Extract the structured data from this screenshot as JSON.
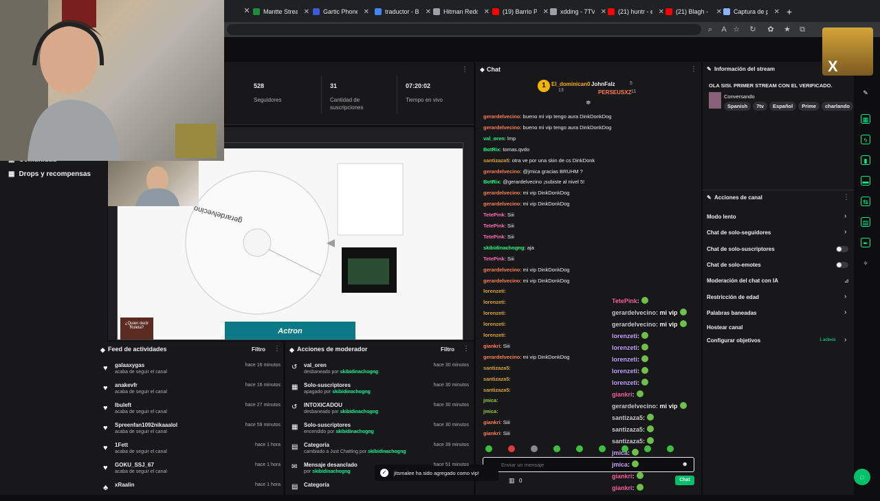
{
  "browser": {
    "tabs": [
      {
        "label": "Mantte Strea",
        "color": "#1e8e3e"
      },
      {
        "label": "Gartic Phone",
        "color": "#3b5bdb"
      },
      {
        "label": "traductor - B",
        "color": "#4285f4"
      },
      {
        "label": "Hitman Redd",
        "color": "#9aa0a6"
      },
      {
        "label": "(19) Barrio P",
        "color": "#ff0000"
      },
      {
        "label": "xdding - 7TV",
        "color": "#9aa0a6"
      },
      {
        "label": "(21) huntr - e",
        "color": "#ff0000"
      },
      {
        "label": "(21) Blagh - l",
        "color": "#ff0000"
      },
      {
        "label": "Captura de p",
        "color": "#8ab4f8"
      }
    ],
    "new_tab": "+"
  },
  "leftnav": {
    "items": [
      {
        "label": "Comunidad"
      },
      {
        "label": "Drops y recompensas"
      }
    ]
  },
  "stats": {
    "items": [
      {
        "value": "528",
        "label": "Seguidores"
      },
      {
        "value": "31",
        "label": "Cantidad de suscripciones"
      },
      {
        "value": "07:20:02",
        "label": "Tiempo en vivo"
      }
    ]
  },
  "preview": {
    "wheel_label": "gerardelvecino",
    "banner": "Actron",
    "thumb_text": "¿Quien decir Ruleta?"
  },
  "activity": {
    "title": "Feed de actividades",
    "filter": "Filtro",
    "rows": [
      {
        "name": "galaaxygas",
        "sub": "acaba de seguir el canal",
        "time": "hace 16 minutos"
      },
      {
        "name": "anakevfr",
        "sub": "acaba de seguir el canal",
        "time": "hace 16 minutos"
      },
      {
        "name": "lbuleft",
        "sub": "acaba de seguir el canal",
        "time": "hace 27 minutos"
      },
      {
        "name": "Spreenfan1092nikaaalol",
        "sub": "acaba de seguir el canal",
        "time": "hace 59 minutos"
      },
      {
        "name": "1Fett",
        "sub": "acaba de seguir el canal",
        "time": "hace 1 hora"
      },
      {
        "name": "GOKU_SSJ_67",
        "sub": "acaba de seguir el canal",
        "time": "hace 1 hora"
      },
      {
        "name": "xRaalin",
        "sub": "",
        "time": "hace 1 hora"
      }
    ]
  },
  "modactions": {
    "title": "Acciones de moderador",
    "filter": "Filtro",
    "rows": [
      {
        "name": "val_oren",
        "sub": "desbaneado por",
        "by": "skibidinachogng",
        "time": "hace 30 minutos"
      },
      {
        "name": "Solo-suscriptores",
        "sub": "apagado por",
        "by": "skibidinachogng",
        "time": "hace 30 minutos"
      },
      {
        "name": "INTOXICADOU",
        "sub": "desbaneado por",
        "by": "skibidinachogng",
        "time": "hace 30 minutos"
      },
      {
        "name": "Solo-suscriptores",
        "sub": "encendido por",
        "by": "skibidinachogng",
        "time": "hace 30 minutos"
      },
      {
        "name": "Categoría",
        "sub": "cambiado a Just Chatting por",
        "by": "skibidinachogng",
        "time": "hace 39 minutos"
      },
      {
        "name": "Mensaje desanclado",
        "sub": "por",
        "by": "skibidinachogng",
        "time": "hace 51 minutos"
      },
      {
        "name": "Categoría",
        "sub": "",
        "by": "",
        "time": ""
      }
    ]
  },
  "chat": {
    "title": "Chat",
    "pinned": {
      "top1": "El_dominican0",
      "top1_count": "13",
      "top2": "JohnFalz",
      "top2_count": "5",
      "top3": "PERSEUSXZ",
      "top3_count": "11"
    },
    "messages": [
      {
        "user": "gerardelvecino",
        "text": ": bueno mi vip tengo aura DinkDonkDog",
        "cls": "u-g"
      },
      {
        "user": "gerardelvecino",
        "text": ": bueno mi vip tengo aura DinkDonkDog",
        "cls": "u-g"
      },
      {
        "user": "val_oren",
        "text": ": lmp",
        "cls": "u-b"
      },
      {
        "user": "BotRix",
        "text": ": tomas.qvdo",
        "cls": "u-b"
      },
      {
        "user": "santizaza5",
        "text": ": otra ve por una skin de cs DinkDonk",
        "cls": "u-y"
      },
      {
        "user": "gerardelvecino",
        "text": ": @jmica gracias BRUHM ?",
        "cls": "u-g"
      },
      {
        "user": "BotRix",
        "text": ": @gerardelvecino ¡subiste al nivel 5!",
        "cls": "u-b"
      },
      {
        "user": "gerardelvecino",
        "text": ": mi vip DinkDonkDog",
        "cls": "u-g"
      },
      {
        "user": "gerardelvecino",
        "text": ": mi vip DinkDonkDog",
        "cls": "u-g"
      },
      {
        "user": "TetePink",
        "text": ": Siii",
        "cls": "u-p"
      },
      {
        "user": "TetePink",
        "text": ": Siii",
        "cls": "u-p"
      },
      {
        "user": "TetePink",
        "text": ": Siii",
        "cls": "u-p"
      },
      {
        "user": "skibidinachogng",
        "text": ": aja",
        "cls": "u-b"
      },
      {
        "user": "TetePink",
        "text": ": Siii",
        "cls": "u-p"
      },
      {
        "user": "gerardelvecino",
        "text": ": mi vip DinkDonkDog",
        "cls": "u-g"
      },
      {
        "user": "gerardelvecino",
        "text": ": mi vip DinkDonkDog",
        "cls": "u-g"
      },
      {
        "user": "lorenzeti",
        "text": ":",
        "cls": "u-y"
      },
      {
        "user": "lorenzeti",
        "text": ":",
        "cls": "u-y"
      },
      {
        "user": "lorenzeti",
        "text": ":",
        "cls": "u-y"
      },
      {
        "user": "lorenzeti",
        "text": ":",
        "cls": "u-y"
      },
      {
        "user": "lorenzeti",
        "text": ":",
        "cls": "u-y"
      },
      {
        "user": "giankri",
        "text": ": Siii",
        "cls": "u-g"
      },
      {
        "user": "gerardelvecino",
        "text": ": mi vip DinkDonkDog",
        "cls": "u-g"
      },
      {
        "user": "santizaza5",
        "text": ":",
        "cls": "u-y"
      },
      {
        "user": "santizaza5",
        "text": ":",
        "cls": "u-y"
      },
      {
        "user": "santizaza5",
        "text": ":",
        "cls": "u-y"
      },
      {
        "user": "jmica",
        "text": ":",
        "cls": "u-c"
      },
      {
        "user": "jmica",
        "text": ":",
        "cls": "u-c"
      },
      {
        "user": "giankri",
        "text": ": Siii",
        "cls": "u-g"
      },
      {
        "user": "giankri",
        "text": ": Siii",
        "cls": "u-g"
      }
    ],
    "overlay": [
      {
        "name": "TetePink",
        "text": ":",
        "cls": "nm-p"
      },
      {
        "name": "gerardelvecino",
        "text": ": mi vip",
        "cls": "nm-g"
      },
      {
        "name": "gerardelvecino",
        "text": ": mi vip",
        "cls": "nm-g"
      },
      {
        "name": "lorenzeti",
        "text": ":",
        "cls": "nm-l"
      },
      {
        "name": "lorenzeti",
        "text": ":",
        "cls": "nm-l"
      },
      {
        "name": "lorenzeti",
        "text": ":",
        "cls": "nm-l"
      },
      {
        "name": "lorenzeti",
        "text": ":",
        "cls": "nm-l"
      },
      {
        "name": "lorenzeti",
        "text": ":",
        "cls": "nm-l"
      },
      {
        "name": "giankri",
        "text": ":",
        "cls": "nm-p"
      },
      {
        "name": "gerardelvecino",
        "text": ": mi vip",
        "cls": "nm-g"
      },
      {
        "name": "santizaza5",
        "text": ":",
        "cls": "nm-g"
      },
      {
        "name": "santizaza5",
        "text": ":",
        "cls": "nm-g"
      },
      {
        "name": "santizaza5",
        "text": ":",
        "cls": "nm-g"
      },
      {
        "name": "jmica",
        "text": ":",
        "cls": "nm-l"
      },
      {
        "name": "jmica",
        "text": ":",
        "cls": "nm-l"
      },
      {
        "name": "giankri",
        "text": ":",
        "cls": "nm-p"
      },
      {
        "name": "giankri",
        "text": ":",
        "cls": "nm-p"
      }
    ],
    "input_placeholder": "Enviar un mensaje",
    "send_label": "Chat",
    "points": "0"
  },
  "streaminfo": {
    "title": "Información del stream",
    "stream_title": "OLA SISI. PRIMER STREAM CON EL VERIFICADO.",
    "category": "Conversando",
    "tags": [
      "Spanish",
      "7tv",
      "Español",
      "Prime",
      "charlando"
    ]
  },
  "channel_actions": {
    "title": "Acciones de canal",
    "items": [
      {
        "label": "Modo lento",
        "kind": "chevron"
      },
      {
        "label": "Chat de solo-seguidores",
        "kind": "chevron"
      },
      {
        "label": "Chat de solo-suscriptores",
        "kind": "toggle"
      },
      {
        "label": "Chat de solo-emotes",
        "kind": "toggle"
      },
      {
        "label": "Moderación del chat con IA",
        "kind": "icon"
      },
      {
        "label": "Restricción de edad",
        "kind": "chevron"
      },
      {
        "label": "Palabras baneadas",
        "kind": "chevron"
      },
      {
        "label": "Hostear canal",
        "kind": "none"
      },
      {
        "label": "Configurar objetivos",
        "kind": "goal"
      }
    ],
    "goal_badge": "1 activos"
  },
  "toast": {
    "text": "jitsmalee ha sido agregado como vip!"
  },
  "colors": {
    "accent": "#00f593",
    "bg": "#18181b",
    "purple": "#9147ff"
  }
}
